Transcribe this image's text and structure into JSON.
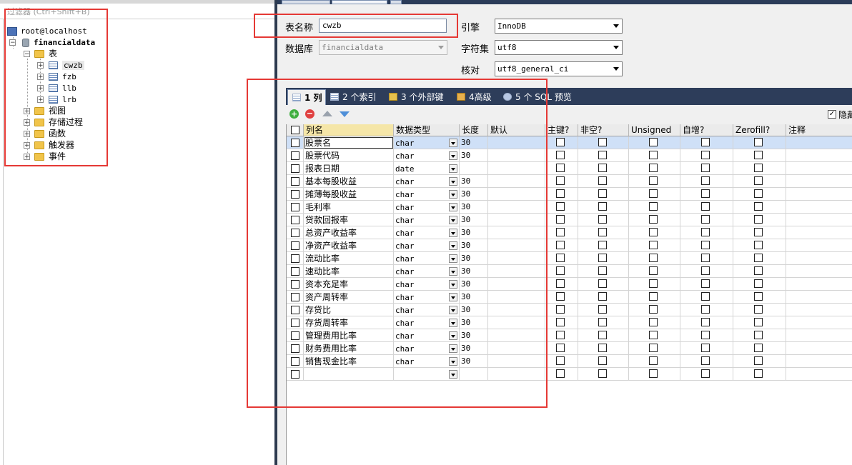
{
  "sidebar": {
    "filter_placeholder": "过滤器 (Ctrl+Shift+B)",
    "root_label": "root@localhost",
    "database_label": "financialdata",
    "tables_folder_label": "表",
    "tables": [
      "cwzb",
      "fzb",
      "llb",
      "lrb"
    ],
    "other_folders": [
      "视图",
      "存储过程",
      "函数",
      "触发器",
      "事件"
    ]
  },
  "form": {
    "table_name_label": "表名称",
    "table_name_value": "cwzb",
    "database_label": "数据库",
    "database_value": "financialdata",
    "engine_label": "引擎",
    "engine_value": "InnoDB",
    "charset_label": "字符集",
    "charset_value": "utf8",
    "collation_label": "核对",
    "collation_value": "utf8_general_ci"
  },
  "tabs": [
    {
      "label": "1 列",
      "active": true
    },
    {
      "label": "2 个索引",
      "active": false
    },
    {
      "label": "3 个外部键",
      "active": false
    },
    {
      "label": "4高级",
      "active": false
    },
    {
      "label": "5 个 SQL 预览",
      "active": false
    }
  ],
  "toolbar": {
    "add_icon": "add-icon",
    "delete_icon": "delete-icon",
    "move_up_icon": "arrow-up-icon",
    "move_down_icon": "arrow-down-icon",
    "hide_label": "隐藏",
    "hide_checked": true
  },
  "grid": {
    "headers": {
      "name": "列名",
      "type": "数据类型",
      "length": "长度",
      "default": "默认",
      "pk": "主键?",
      "notnull": "非空?",
      "unsigned": "Unsigned",
      "autoinc": "自增?",
      "zerofill": "Zerofill?",
      "comment": "注释"
    },
    "rows": [
      {
        "name": "股票名",
        "type": "char",
        "length": "30"
      },
      {
        "name": "股票代码",
        "type": "char",
        "length": "30"
      },
      {
        "name": "报表日期",
        "type": "date",
        "length": ""
      },
      {
        "name": "基本每股收益",
        "type": "char",
        "length": "30"
      },
      {
        "name": "摊薄每股收益",
        "type": "char",
        "length": "30"
      },
      {
        "name": "毛利率",
        "type": "char",
        "length": "30"
      },
      {
        "name": "贷款回报率",
        "type": "char",
        "length": "30"
      },
      {
        "name": "总资产收益率",
        "type": "char",
        "length": "30"
      },
      {
        "name": "净资产收益率",
        "type": "char",
        "length": "30"
      },
      {
        "name": "流动比率",
        "type": "char",
        "length": "30"
      },
      {
        "name": "速动比率",
        "type": "char",
        "length": "30"
      },
      {
        "name": "资本充足率",
        "type": "char",
        "length": "30"
      },
      {
        "name": "资产周转率",
        "type": "char",
        "length": "30"
      },
      {
        "name": "存贷比",
        "type": "char",
        "length": "30"
      },
      {
        "name": "存货周转率",
        "type": "char",
        "length": "30"
      },
      {
        "name": "管理费用比率",
        "type": "char",
        "length": "30"
      },
      {
        "name": "财务费用比率",
        "type": "char",
        "length": "30"
      },
      {
        "name": "销售现金比率",
        "type": "char",
        "length": "30"
      },
      {
        "name": "",
        "type": "",
        "length": ""
      }
    ]
  },
  "colors": {
    "annotation_red": "#e53935",
    "selection_blue": "#cfe0f7",
    "tab_bar_navy": "#2d3d5a"
  }
}
